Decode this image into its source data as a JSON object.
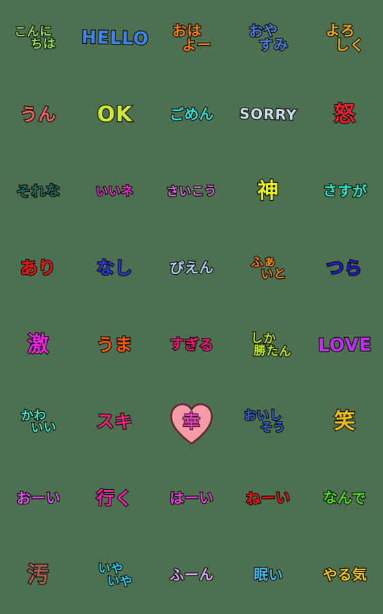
{
  "page": {
    "title": "Handwritten Japanese Emoji Sticker Sheet",
    "background_color": "#4d7050",
    "outline_color": "#100d08",
    "columns": 5,
    "rows": 8,
    "cell_size": 112
  },
  "stickers": [
    {
      "id": "konnichiwa",
      "lines": [
        "こんに",
        "ちは"
      ],
      "text": "こんにちは",
      "color": "#8fdd55",
      "size": "sz-s",
      "tilt": "tilt-c",
      "script": "kana",
      "shape": "none"
    },
    {
      "id": "hello",
      "lines": [
        "HELLO"
      ],
      "text": "HELLO",
      "color": "#3f84e8",
      "size": "sz-l",
      "tilt": "tilt-b",
      "script": "latin",
      "shape": "none"
    },
    {
      "id": "ohayo",
      "lines": [
        "おは",
        "よー"
      ],
      "text": "おはよー",
      "color": "#f57c0e",
      "size": "sz-m",
      "tilt": "tilt-c",
      "script": "kana",
      "shape": "none"
    },
    {
      "id": "oyasumi",
      "lines": [
        "おや",
        "すみ"
      ],
      "text": "おやすみ",
      "color": "#4a7be0",
      "size": "sz-m",
      "tilt": "tilt-a",
      "script": "kana",
      "shape": "none"
    },
    {
      "id": "yoroshiku",
      "lines": [
        "よろ",
        "しく"
      ],
      "text": "よろしく",
      "color": "#f0a81e",
      "size": "sz-m",
      "tilt": "tilt-b",
      "script": "kana",
      "shape": "none"
    },
    {
      "id": "un",
      "lines": [
        "うん"
      ],
      "text": "うん",
      "color": "#f0625c",
      "size": "sz-l",
      "tilt": "tilt-c",
      "script": "kana",
      "shape": "none"
    },
    {
      "id": "ok",
      "lines": [
        "OK"
      ],
      "text": "OK",
      "color": "#cfe838",
      "size": "sz-xl",
      "tilt": "tilt-e",
      "script": "latin",
      "shape": "none"
    },
    {
      "id": "gomen",
      "lines": [
        "ごめん"
      ],
      "text": "ごめん",
      "color": "#2fe3e0",
      "size": "sz-m",
      "tilt": "tilt-c",
      "script": "kana",
      "shape": "none"
    },
    {
      "id": "sorry",
      "lines": [
        "SORRY"
      ],
      "text": "SORRY",
      "color": "#c9dced",
      "size": "sz-m",
      "tilt": "tilt-b",
      "script": "latin",
      "shape": "none"
    },
    {
      "id": "okoru",
      "lines": [
        "怒"
      ],
      "text": "怒",
      "color": "#ee1f2d",
      "size": "sz-xl",
      "tilt": "tilt-e",
      "script": "kanji",
      "shape": "none"
    },
    {
      "id": "sorena",
      "lines": [
        "それな"
      ],
      "text": "それな",
      "color": "#1c6b5a",
      "size": "sz-m",
      "tilt": "tilt-a",
      "script": "kana",
      "shape": "none"
    },
    {
      "id": "iine",
      "lines": [
        "いいネ"
      ],
      "text": "いいネ",
      "color": "#f021cf",
      "size": "sz-s",
      "tilt": "tilt-c",
      "script": "kana",
      "shape": "none"
    },
    {
      "id": "saikou",
      "lines": [
        "さいこう"
      ],
      "text": "さいこう",
      "color": "#dc6be0",
      "size": "sz-s",
      "tilt": "tilt-c",
      "script": "kana",
      "shape": "none"
    },
    {
      "id": "kami",
      "lines": [
        "神"
      ],
      "text": "神",
      "color": "#e8f018",
      "size": "sz-xl",
      "tilt": "tilt-e",
      "script": "kanji",
      "shape": "none"
    },
    {
      "id": "sasuga",
      "lines": [
        "さすが"
      ],
      "text": "さすが",
      "color": "#25e8c6",
      "size": "sz-m",
      "tilt": "tilt-b",
      "script": "kana",
      "shape": "none"
    },
    {
      "id": "ari",
      "lines": [
        "あり"
      ],
      "text": "あり",
      "color": "#ee1515",
      "size": "sz-l",
      "tilt": "tilt-c",
      "script": "kana",
      "shape": "none"
    },
    {
      "id": "nashi",
      "lines": [
        "なし"
      ],
      "text": "なし",
      "color": "#2436dd",
      "size": "sz-l",
      "tilt": "tilt-b",
      "script": "kana",
      "shape": "none"
    },
    {
      "id": "pien",
      "lines": [
        "ぴえん"
      ],
      "text": "ぴえん",
      "color": "#a8cbf0",
      "size": "sz-m",
      "tilt": "tilt-c",
      "script": "kana",
      "shape": "none"
    },
    {
      "id": "fight",
      "lines": [
        "ふぁ",
        "いと"
      ],
      "text": "ふぁいと",
      "color": "#f5820a",
      "size": "sz-s",
      "tilt": "tilt-a",
      "script": "kana",
      "shape": "none"
    },
    {
      "id": "tsura",
      "lines": [
        "つら"
      ],
      "text": "つら",
      "color": "#1a1ad8",
      "size": "sz-l",
      "tilt": "tilt-b",
      "script": "kana",
      "shape": "none"
    },
    {
      "id": "geki",
      "lines": [
        "激"
      ],
      "text": "激",
      "color": "#ed21e3",
      "size": "sz-xl",
      "tilt": "tilt-e",
      "script": "kanji",
      "shape": "none"
    },
    {
      "id": "uma",
      "lines": [
        "うま"
      ],
      "text": "うま",
      "color": "#fa5a0a",
      "size": "sz-l",
      "tilt": "tilt-c",
      "script": "kana",
      "shape": "none"
    },
    {
      "id": "sugiru",
      "lines": [
        "すぎる"
      ],
      "text": "すぎる",
      "color": "#f5147d",
      "size": "sz-m",
      "tilt": "tilt-b",
      "script": "kana",
      "shape": "none"
    },
    {
      "id": "shikakatan",
      "lines": [
        "しか",
        "勝たん"
      ],
      "text": "しか勝たん",
      "color": "#bbe81a",
      "size": "sz-s",
      "tilt": "tilt-d",
      "script": "mixed",
      "shape": "none"
    },
    {
      "id": "love",
      "lines": [
        "LOVE"
      ],
      "text": "LOVE",
      "color": "#c02ef5",
      "size": "sz-l",
      "tilt": "tilt-c",
      "script": "latin",
      "shape": "none"
    },
    {
      "id": "kawaii",
      "lines": [
        "かわ",
        "いい"
      ],
      "text": "かわいい",
      "color": "#2ff0c9",
      "size": "sz-s",
      "tilt": "tilt-a",
      "script": "kana",
      "shape": "none"
    },
    {
      "id": "suki",
      "lines": [
        "スキ"
      ],
      "text": "スキ",
      "color": "#f0247d",
      "size": "sz-l",
      "tilt": "tilt-b",
      "script": "kana",
      "shape": "none"
    },
    {
      "id": "shiawase-heart",
      "lines": [
        "幸"
      ],
      "text": "幸",
      "color": "#e03fb4",
      "size": "sz-l",
      "tilt": "tilt-e",
      "script": "kanji",
      "shape": "heart",
      "shape_fill": "#f79bab",
      "shape_stroke": "#5a2733"
    },
    {
      "id": "oishisou",
      "lines": [
        "おいし",
        "そう"
      ],
      "text": "おいしそう",
      "color": "#2a63d6",
      "size": "sz-s",
      "tilt": "tilt-c",
      "script": "kana",
      "shape": "none"
    },
    {
      "id": "warai",
      "lines": [
        "笑"
      ],
      "text": "笑",
      "color": "#f0c01a",
      "size": "sz-xl",
      "tilt": "tilt-e",
      "script": "kanji",
      "shape": "none"
    },
    {
      "id": "ooi",
      "lines": [
        "おーい"
      ],
      "text": "おーい",
      "color": "#e04ff0",
      "size": "sz-m",
      "tilt": "tilt-c",
      "script": "kana",
      "shape": "none"
    },
    {
      "id": "iku",
      "lines": [
        "行く"
      ],
      "text": "行く",
      "color": "#f51fb0",
      "size": "sz-l",
      "tilt": "tilt-b",
      "script": "mixed",
      "shape": "none"
    },
    {
      "id": "haai",
      "lines": [
        "はーい"
      ],
      "text": "はーい",
      "color": "#e83fe0",
      "size": "sz-m",
      "tilt": "tilt-c",
      "script": "kana",
      "shape": "none"
    },
    {
      "id": "neei",
      "lines": [
        "ねーい"
      ],
      "text": "ねーい",
      "color": "#ee1212",
      "size": "sz-m",
      "tilt": "tilt-a",
      "script": "kana",
      "shape": "none"
    },
    {
      "id": "nande",
      "lines": [
        "なんで"
      ],
      "text": "なんで",
      "color": "#4be025",
      "size": "sz-m",
      "tilt": "tilt-b",
      "script": "kana",
      "shape": "none"
    },
    {
      "id": "kitanai",
      "lines": [
        "汚"
      ],
      "text": "汚",
      "color": "#b05a50",
      "size": "sz-xl",
      "tilt": "tilt-e",
      "script": "kanji",
      "shape": "none"
    },
    {
      "id": "iyaiya",
      "lines": [
        "いや",
        "いや"
      ],
      "text": "いやいや",
      "color": "#1fd0f0",
      "size": "sz-s",
      "tilt": "tilt-d",
      "script": "kana",
      "shape": "none"
    },
    {
      "id": "fuun",
      "lines": [
        "ふーん"
      ],
      "text": "ふーん",
      "color": "#d8a8f5",
      "size": "sz-m",
      "tilt": "tilt-c",
      "script": "kana",
      "shape": "none"
    },
    {
      "id": "nemui",
      "lines": [
        "眠い"
      ],
      "text": "眠い",
      "color": "#45b8e8",
      "size": "sz-m",
      "tilt": "tilt-b",
      "script": "mixed",
      "shape": "none"
    },
    {
      "id": "yaruki",
      "lines": [
        "やる気"
      ],
      "text": "やる気",
      "color": "#f0c81a",
      "size": "sz-m",
      "tilt": "tilt-c",
      "script": "mixed",
      "shape": "none"
    }
  ]
}
